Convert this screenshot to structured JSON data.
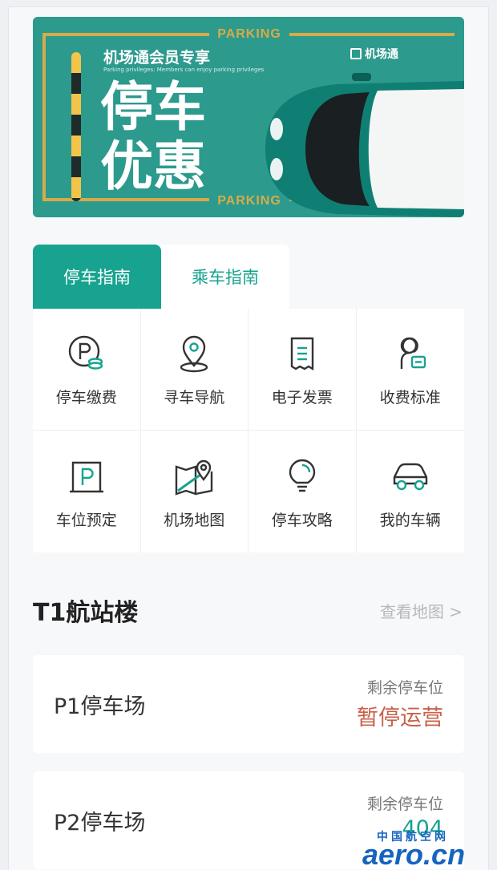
{
  "banner": {
    "member_title": "机场通会员专享",
    "member_subtitle": "Parking privileges: Members can enjoy parking privileges",
    "headline": "停车优惠",
    "brand": "机场通",
    "parking_word": "PARKING",
    "colors": {
      "background": "#2c9a8d",
      "gold": "#d8ab4a"
    }
  },
  "tabs": [
    {
      "label": "停车指南",
      "active": true
    },
    {
      "label": "乘车指南",
      "active": false
    }
  ],
  "services": [
    {
      "label": "停车缴费",
      "icon": "parking-pay-icon"
    },
    {
      "label": "寻车导航",
      "icon": "location-pin-icon"
    },
    {
      "label": "电子发票",
      "icon": "invoice-icon"
    },
    {
      "label": "收费标准",
      "icon": "fee-standard-icon"
    },
    {
      "label": "车位预定",
      "icon": "parking-space-icon"
    },
    {
      "label": "机场地图",
      "icon": "map-icon"
    },
    {
      "label": "停车攻略",
      "icon": "lightbulb-icon"
    },
    {
      "label": "我的车辆",
      "icon": "car-icon"
    }
  ],
  "terminal": {
    "title": "T1航站楼",
    "view_map": "查看地图 >"
  },
  "lots": [
    {
      "name": "P1停车场",
      "remaining_label": "剩余停车位",
      "status": "暂停运营"
    },
    {
      "name": "P2停车场",
      "remaining_label": "剩余停车位",
      "status": "404"
    }
  ],
  "watermark": {
    "cn": "中国航空网",
    "en": "aero.cn"
  },
  "colors": {
    "accent": "#17a38f",
    "paused": "#c8604a"
  }
}
